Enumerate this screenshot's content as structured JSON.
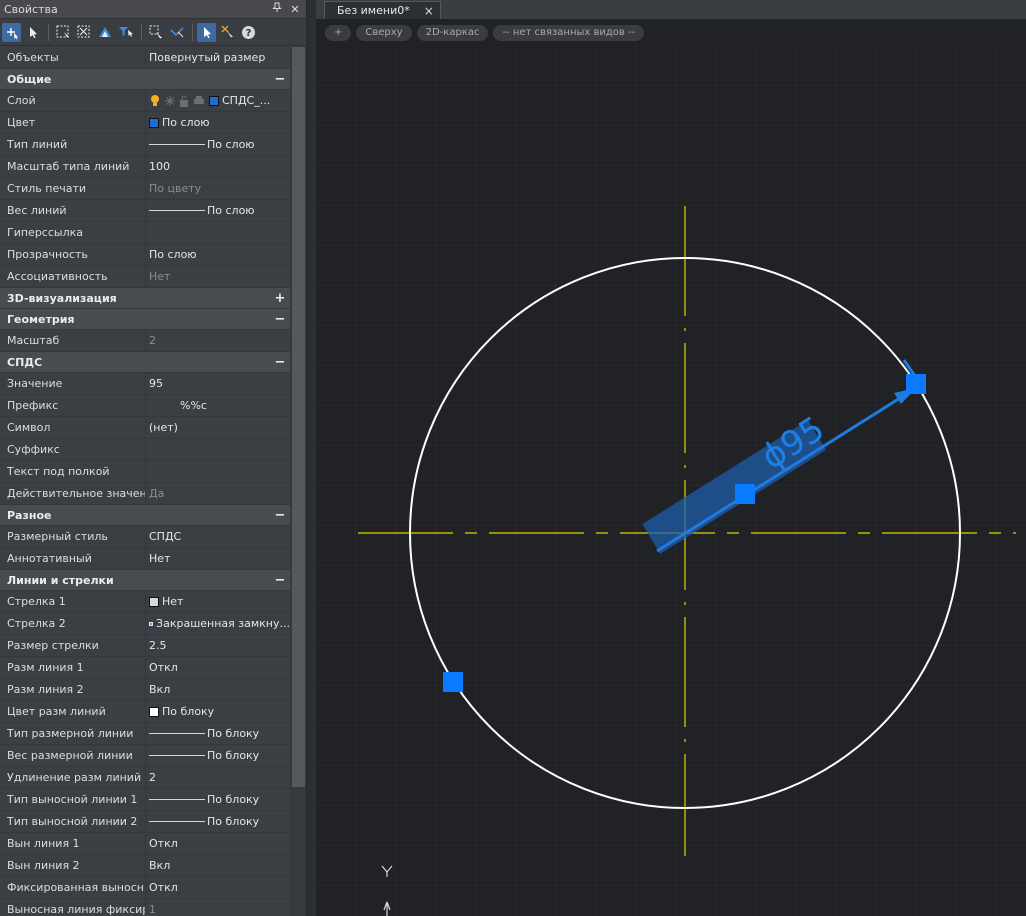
{
  "panel": {
    "title": "Свойства",
    "pin_icon": "pin-icon",
    "close_icon": "close-icon",
    "toolbar_icons": [
      "add-selection-icon",
      "select-icon",
      "window-select-icon",
      "cross-select-icon",
      "select-similar-icon",
      "filter-icon",
      "quick-select-icon",
      "deselect-icon",
      "pick-add-icon",
      "clear-selection-icon",
      "help-icon"
    ]
  },
  "rows": [
    {
      "type": "row",
      "k": "Объекты",
      "v": "Повернутый размер"
    },
    {
      "type": "group",
      "k": "Общие",
      "pm": "−"
    },
    {
      "type": "row",
      "k": "Слой",
      "v": "СПДС_...",
      "kind": "layer"
    },
    {
      "type": "row",
      "k": "Цвет",
      "v": "По слою",
      "kind": "color",
      "color": "#1e6fd0"
    },
    {
      "type": "row",
      "k": "Тип линий",
      "v": "По слою",
      "kind": "line"
    },
    {
      "type": "row",
      "k": "Масштаб типа линий",
      "v": "100"
    },
    {
      "type": "row",
      "k": "Стиль печати",
      "v": "По цвету",
      "dim": true
    },
    {
      "type": "row",
      "k": "Вес линий",
      "v": "По слою",
      "kind": "line"
    },
    {
      "type": "row",
      "k": "Гиперссылка",
      "v": ""
    },
    {
      "type": "row",
      "k": "Прозрачность",
      "v": "По слою"
    },
    {
      "type": "row",
      "k": "Ассоциативность",
      "v": "Нет",
      "dim": true
    },
    {
      "type": "group",
      "k": "3D-визуализация",
      "pm": "+"
    },
    {
      "type": "group",
      "k": "Геометрия",
      "pm": "−"
    },
    {
      "type": "row",
      "k": "Масштаб",
      "v": "2",
      "dim": true
    },
    {
      "type": "group",
      "k": "СПДС",
      "pm": "−"
    },
    {
      "type": "row",
      "k": "Значение",
      "v": "95"
    },
    {
      "type": "row",
      "k": "Префикс",
      "v": "%%c",
      "pad": true
    },
    {
      "type": "row",
      "k": "Символ",
      "v": "(нет)"
    },
    {
      "type": "row",
      "k": "Суффикс",
      "v": ""
    },
    {
      "type": "row",
      "k": "Текст под полкой",
      "v": ""
    },
    {
      "type": "row",
      "k": "Действительное значение",
      "v": "Да",
      "dim": true
    },
    {
      "type": "group",
      "k": "Разное",
      "pm": "−"
    },
    {
      "type": "row",
      "k": "Размерный стиль",
      "v": "СПДС"
    },
    {
      "type": "row",
      "k": "Аннотативный",
      "v": "Нет"
    },
    {
      "type": "group",
      "k": "Линии и стрелки",
      "pm": "−"
    },
    {
      "type": "row",
      "k": "Стрелка 1",
      "v": "Нет",
      "kind": "color",
      "color": "#d8d8d8"
    },
    {
      "type": "row",
      "k": "Стрелка 2",
      "v": "Закрашенная замкну...",
      "kind": "arrow"
    },
    {
      "type": "row",
      "k": "Размер стрелки",
      "v": "2.5"
    },
    {
      "type": "row",
      "k": "Разм линия 1",
      "v": "Откл"
    },
    {
      "type": "row",
      "k": "Разм линия 2",
      "v": "Вкл"
    },
    {
      "type": "row",
      "k": "Цвет разм линий",
      "v": "По блоку",
      "kind": "color",
      "color": "#ffffff"
    },
    {
      "type": "row",
      "k": "Тип размерной линии",
      "v": "По блоку",
      "kind": "line"
    },
    {
      "type": "row",
      "k": "Вес размерной линии",
      "v": "По блоку",
      "kind": "line"
    },
    {
      "type": "row",
      "k": "Удлинение разм линий",
      "v": "2"
    },
    {
      "type": "row",
      "k": "Тип выносной линии 1",
      "v": "По блоку",
      "kind": "line"
    },
    {
      "type": "row",
      "k": "Тип выносной линии 2",
      "v": "По блоку",
      "kind": "line"
    },
    {
      "type": "row",
      "k": "Вын линия 1",
      "v": "Откл"
    },
    {
      "type": "row",
      "k": "Вын линия 2",
      "v": "Вкл"
    },
    {
      "type": "row",
      "k": "Фиксированная выносн...",
      "v": "Откл"
    },
    {
      "type": "row",
      "k": "Выносная линия фиксир...",
      "v": "1",
      "dim": true
    }
  ],
  "viewport": {
    "tab_title": "Без имени0*",
    "tab_close": "×",
    "controls": [
      "+",
      "Сверху",
      "2D-каркас",
      "-- нет связанных видов --"
    ],
    "dimension_text": "ϕ95",
    "colors": {
      "circle": "#ffffff",
      "centerline": "#e3d200",
      "dimension": "#1e7be0",
      "grip": "#0a7bff"
    }
  }
}
